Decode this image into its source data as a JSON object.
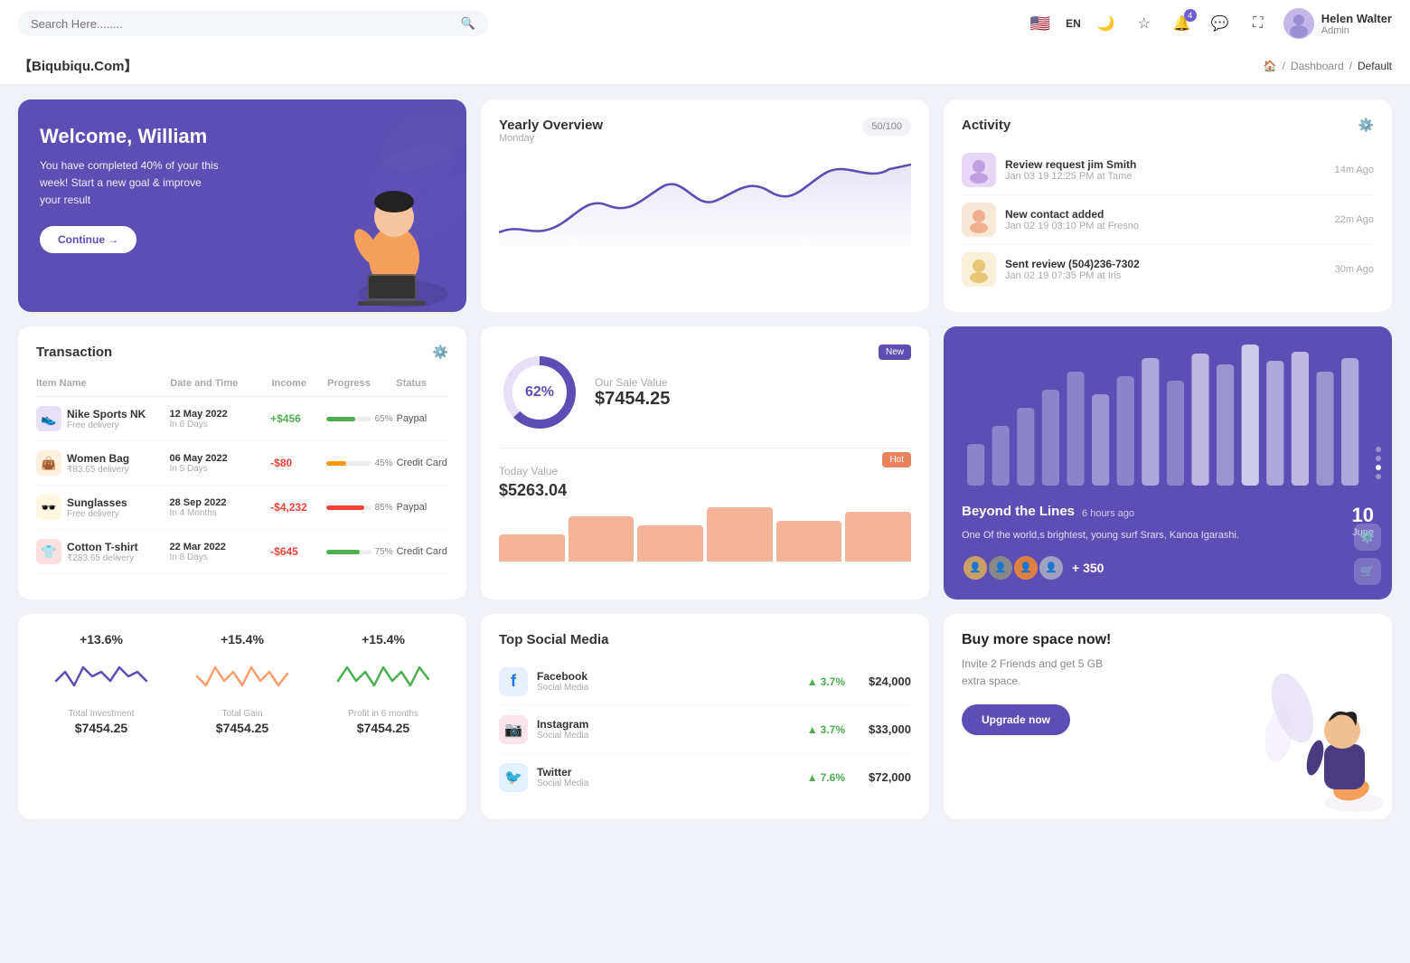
{
  "topbar": {
    "search_placeholder": "Search Here........",
    "lang": "EN",
    "user": {
      "name": "Helen Walter",
      "role": "Admin"
    },
    "notification_count": "4"
  },
  "breadcrumb": {
    "brand": "【Biqubiqu.Com】",
    "home": "🏠",
    "path1": "Dashboard",
    "path2": "Default"
  },
  "welcome": {
    "title": "Welcome, William",
    "subtitle": "You have completed 40% of your this week! Start a new goal & improve your result",
    "button": "Continue →"
  },
  "yearly_overview": {
    "title": "Yearly Overview",
    "subtitle": "Monday",
    "badge": "50/100"
  },
  "activity": {
    "title": "Activity",
    "items": [
      {
        "title": "Review request jim Smith",
        "subtitle": "Jan 03 19 12:25 PM at Tame",
        "time": "14m Ago"
      },
      {
        "title": "New contact added",
        "subtitle": "Jan 02 19 03:10 PM at Fresno",
        "time": "22m Ago"
      },
      {
        "title": "Sent review (504)236-7302",
        "subtitle": "Jan 02 19 07:35 PM at Iris",
        "time": "30m Ago"
      }
    ]
  },
  "transaction": {
    "title": "Transaction",
    "columns": [
      "Item Name",
      "Date and Time",
      "Income",
      "Progress",
      "Status"
    ],
    "rows": [
      {
        "icon": "👟",
        "icon_bg": "#e8e0f8",
        "name": "Nike Sports NK",
        "sub": "Free delivery",
        "date": "12 May 2022",
        "date_sub": "In 6 Days",
        "income": "+$456",
        "income_type": "pos",
        "progress": 65,
        "progress_color": "#4caf50",
        "status": "Paypal"
      },
      {
        "icon": "👜",
        "icon_bg": "#fff0e0",
        "name": "Women Bag",
        "sub": "₹83.65 delivery",
        "date": "06 May 2022",
        "date_sub": "In 5 Days",
        "income": "-$80",
        "income_type": "neg",
        "progress": 45,
        "progress_color": "#ff9800",
        "status": "Credit Card"
      },
      {
        "icon": "🕶️",
        "icon_bg": "#fff8e0",
        "name": "Sunglasses",
        "sub": "Free delivery",
        "date": "28 Sep 2022",
        "date_sub": "In 4 Months",
        "income": "-$4,232",
        "income_type": "neg",
        "progress": 85,
        "progress_color": "#f44336",
        "status": "Paypal"
      },
      {
        "icon": "👕",
        "icon_bg": "#ffe0e0",
        "name": "Cotton T-shirt",
        "sub": "₹283.65 delivery",
        "date": "22 Mar 2022",
        "date_sub": "In 8 Days",
        "income": "-$645",
        "income_type": "neg",
        "progress": 75,
        "progress_color": "#4caf50",
        "status": "Credit Card"
      }
    ]
  },
  "sales": {
    "donut_pct": "62%",
    "label": "Our Sale Value",
    "value": "$7454.25",
    "new_badge": "New",
    "today_label": "Today Value",
    "today_value": "$5263.04",
    "hot_badge": "Hot",
    "bars": [
      30,
      50,
      40,
      60,
      45,
      55
    ]
  },
  "beyond": {
    "title": "Beyond the Lines",
    "time": "6 hours ago",
    "desc": "One Of the world,s brightest, young surf Srars, Kanoa Igarashi.",
    "count": "+ 350",
    "day": "10",
    "month": "June",
    "bar_data": [
      20,
      35,
      55,
      70,
      85,
      65,
      80,
      90,
      75,
      95,
      88,
      100,
      85,
      92,
      78,
      88
    ]
  },
  "stats": {
    "items": [
      {
        "pct": "+13.6%",
        "label": "Total Investment",
        "value": "$7454.25",
        "color": "#5c4eb5"
      },
      {
        "pct": "+15.4%",
        "label": "Total Gain",
        "value": "$7454.25",
        "color": "#ff9d6c"
      },
      {
        "pct": "+15.4%",
        "label": "Profit in 6 months",
        "value": "$7454.25",
        "color": "#4caf50"
      }
    ]
  },
  "social": {
    "title": "Top Social Media",
    "items": [
      {
        "name": "Facebook",
        "type": "Social Media",
        "growth": "3.7%",
        "amount": "$24,000",
        "color": "#1877f2",
        "icon": "f"
      },
      {
        "name": "Instagram",
        "type": "Social Media",
        "growth": "3.7%",
        "amount": "$33,000",
        "color": "#e1306c",
        "icon": "📷"
      },
      {
        "name": "Twitter",
        "type": "Social Media",
        "growth": "7.6%",
        "amount": "$72,000",
        "color": "#1da1f2",
        "icon": "🐦"
      }
    ]
  },
  "buy_space": {
    "title": "Buy more space now!",
    "desc": "Invite 2 Friends and get 5 GB extra space.",
    "button": "Upgrade now"
  }
}
